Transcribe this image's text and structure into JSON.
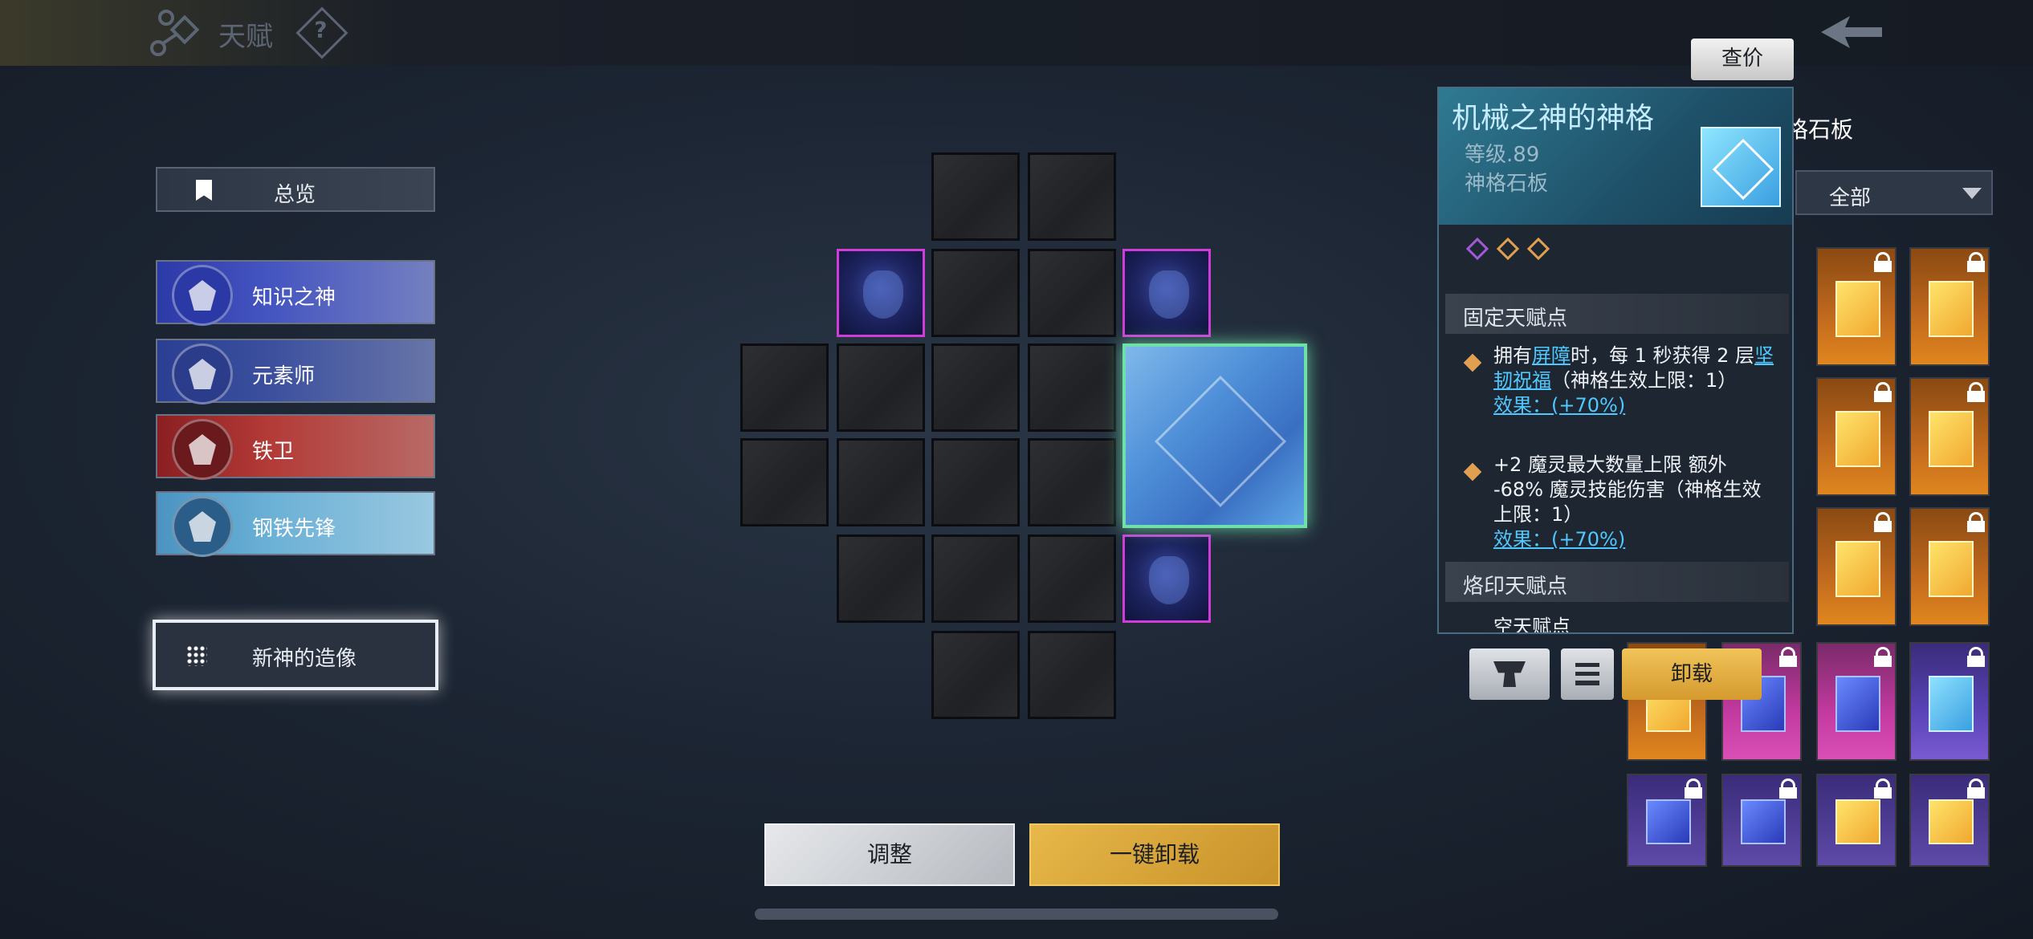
{
  "header": {
    "title": "天赋",
    "help_label": "?"
  },
  "sidebar": {
    "overview_label": "总览",
    "gods": [
      {
        "label": "知识之神"
      },
      {
        "label": "元素师"
      },
      {
        "label": "铁卫"
      },
      {
        "label": "钢铁先锋"
      }
    ],
    "statue_label": "新神的造像"
  },
  "actions": {
    "adjust_label": "调整",
    "unload_all_label": "一键卸载"
  },
  "right_panel": {
    "price_label": "查价",
    "slate_heading_partial": "格石板",
    "filter_value": "全部",
    "unload_label": "卸载"
  },
  "card": {
    "name": "机械之神的神格",
    "level": "等级.89",
    "type": "神格石板",
    "fixed_section": "固定天赋点",
    "t1_prefix": "拥有",
    "t1_link1": "屏障",
    "t1_mid": "时，每 1 秒获得 2 层",
    "t1_link2": "坚韧祝福",
    "t1_suffix": "（神格生效上限：1）",
    "t1_effect": "效果：(+70%)",
    "t2_line": "+2 魔灵最大数量上限 额外 -68% 魔灵技能伤害（神格生效上限：1）",
    "t2_effect": "效果：(+70%)",
    "brand_section": "烙印天赋点",
    "brand_partial": "空天赋点"
  },
  "colors": {
    "accent_gold": "#e7b84a",
    "selected_border": "#6fe0a8",
    "purple_slot": "#d03cd8",
    "link_blue": "#4fc8ff"
  }
}
